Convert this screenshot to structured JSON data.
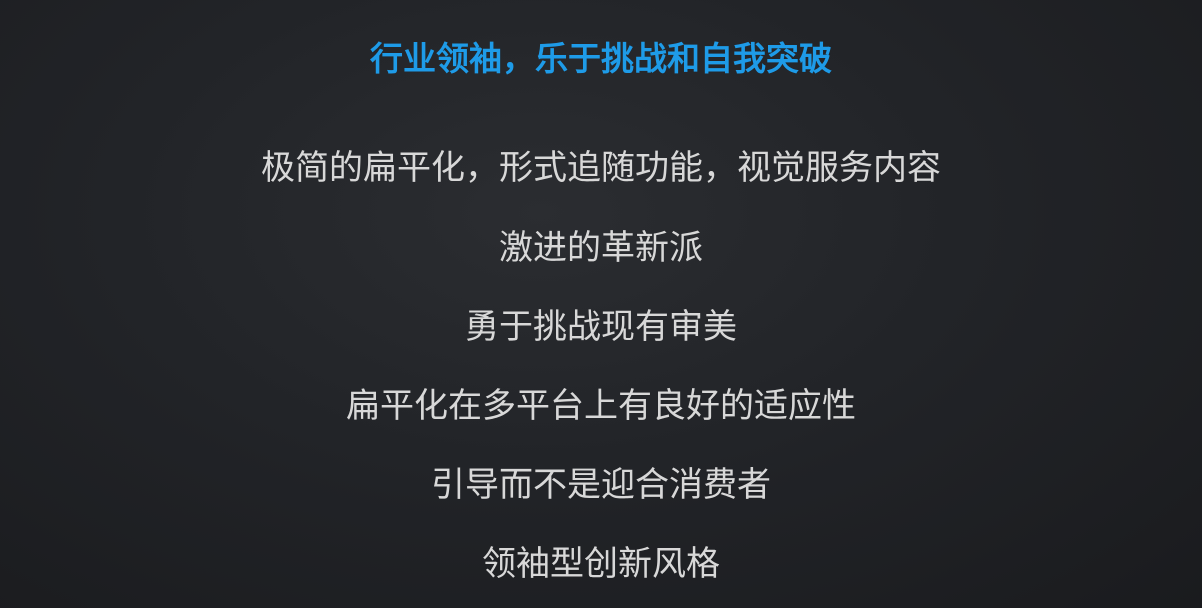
{
  "title": "行业领袖，乐于挑战和自我突破",
  "lines": [
    "极简的扁平化，形式追随功能，视觉服务内容",
    "激进的革新派",
    "勇于挑战现有审美",
    "扁平化在多平台上有良好的适应性",
    "引导而不是迎合消费者",
    "领袖型创新风格"
  ],
  "colors": {
    "title": "#1e9be8",
    "text": "#d8d8d8",
    "background": "#222428"
  }
}
